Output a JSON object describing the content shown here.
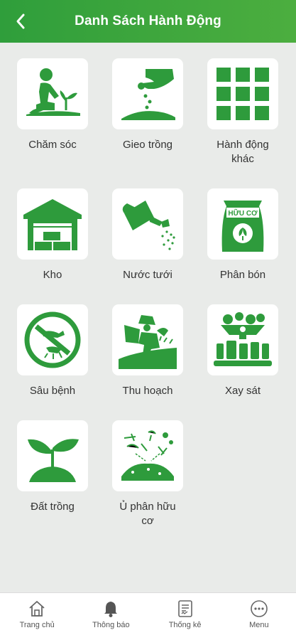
{
  "header": {
    "title": "Danh Sách Hành Động",
    "back_icon": "chevron-left-icon"
  },
  "colors": {
    "primary": "#2e9b3c",
    "icon_green": "#2e9b3c",
    "background": "#e9ebe9"
  },
  "actions": [
    {
      "label": "Chăm sóc",
      "icon": "gardener-icon"
    },
    {
      "label": "Gieo trồng",
      "icon": "sowing-hand-icon"
    },
    {
      "label": "Hành động khác",
      "icon": "grid-icon"
    },
    {
      "label": "Kho",
      "icon": "warehouse-icon"
    },
    {
      "label": "Nước tưới",
      "icon": "watering-can-icon"
    },
    {
      "label": "Phân bón",
      "icon": "fertilizer-bag-icon",
      "badge_text": "HỮU CƠ"
    },
    {
      "label": "Sâu bệnh",
      "icon": "no-pests-icon"
    },
    {
      "label": "Thu hoạch",
      "icon": "harvest-icon"
    },
    {
      "label": "Xay sát",
      "icon": "processing-factory-icon"
    },
    {
      "label": "Đất trồng",
      "icon": "sprout-soil-icon"
    },
    {
      "label": "Ủ phân hữu cơ",
      "icon": "compost-icon"
    }
  ],
  "bottom_nav": [
    {
      "label": "Trang chủ",
      "icon": "home-icon"
    },
    {
      "label": "Thông báo",
      "icon": "bell-icon"
    },
    {
      "label": "Thống kê",
      "icon": "report-icon"
    },
    {
      "label": "Menu",
      "icon": "more-icon"
    }
  ]
}
